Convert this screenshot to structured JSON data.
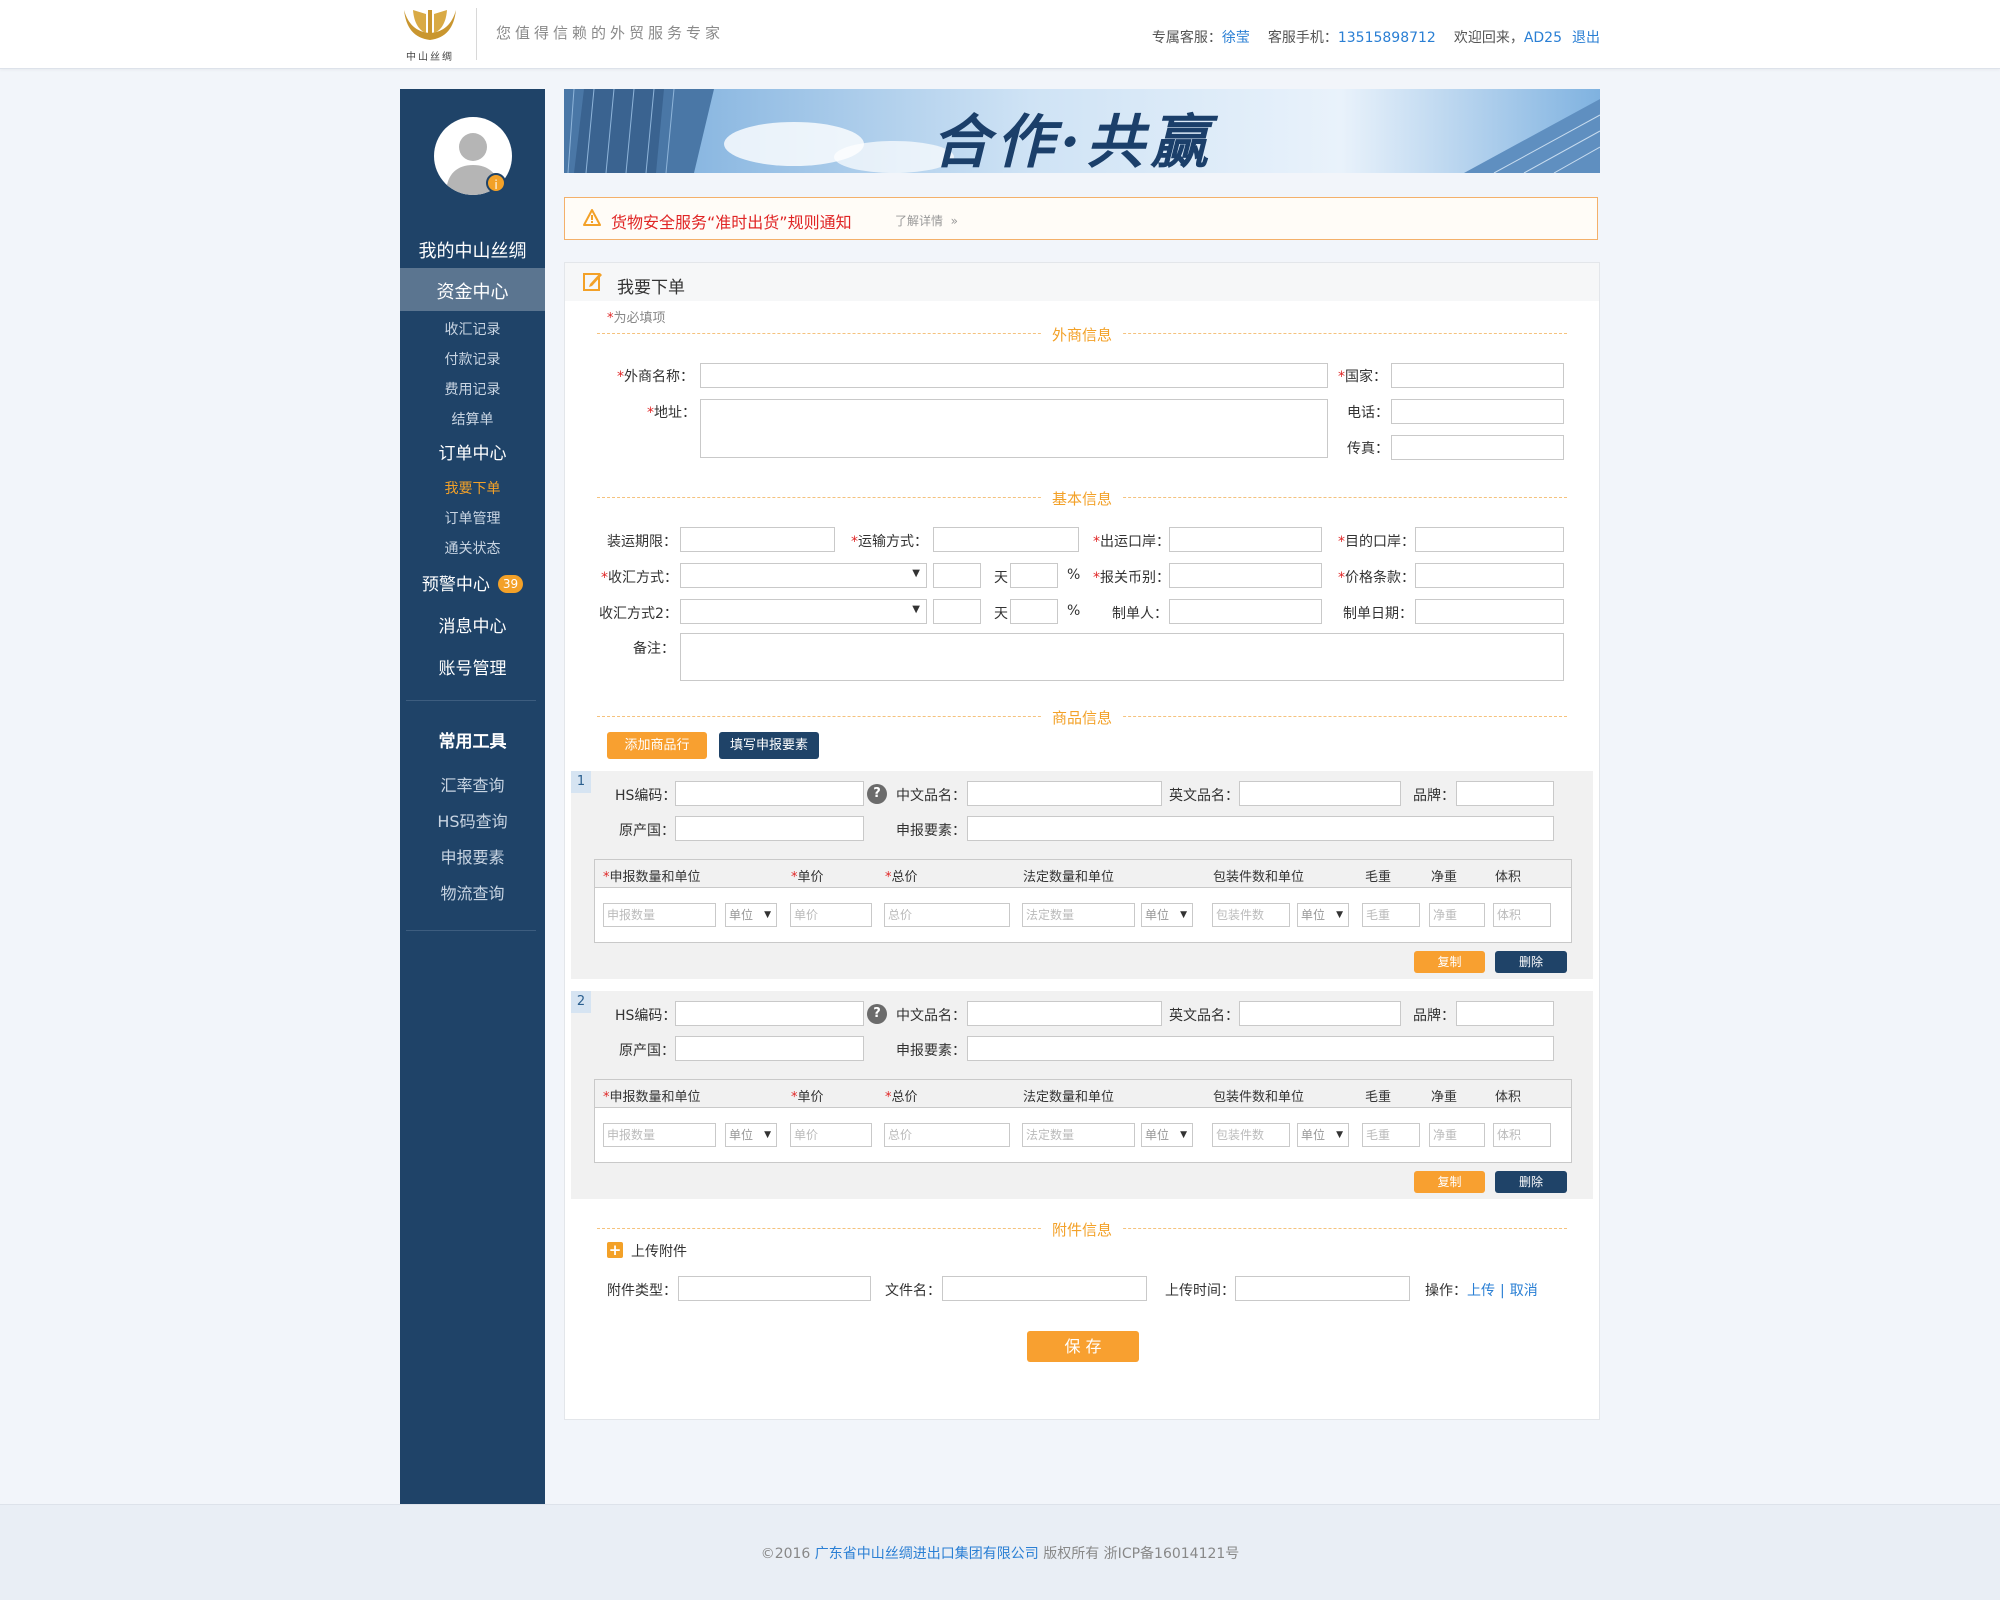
{
  "header": {
    "logo_text": "中山丝绸",
    "slogan": "您值得信赖的外贸服务专家",
    "service_label": "专属客服：",
    "service_name": "徐莹",
    "phone_label": "客服手机：",
    "phone": "13515898712",
    "welcome": "欢迎回来，",
    "user": "AD25",
    "logout": "退出"
  },
  "sidebar": {
    "my": "我的中山丝绸",
    "fund": "资金中心",
    "fund_items": [
      "收汇记录",
      "付款记录",
      "费用记录",
      "结算单"
    ],
    "order": "订单中心",
    "order_items": [
      "我要下单",
      "订单管理",
      "通关状态"
    ],
    "alert": "预警中心",
    "alert_count": "39",
    "message": "消息中心",
    "account": "账号管理",
    "tools": "常用工具",
    "tool_items": [
      "汇率查询",
      "HS码查询",
      "申报要素",
      "物流查询"
    ]
  },
  "banner": {
    "text": "合作·共赢"
  },
  "notice": {
    "text": "货物安全服务“准时出货”规则通知",
    "more": "了解详情",
    "more_arrow": "»"
  },
  "panel": {
    "title": "我要下单",
    "required_star": "*",
    "required_note": "为必填项"
  },
  "sections": {
    "foreign": "外商信息",
    "basic": "基本信息",
    "goods": "商品信息",
    "attach": "附件信息"
  },
  "foreign": {
    "name": "外商名称：",
    "country": "国家：",
    "address": "地址：",
    "phone": "电话：",
    "fax": "传真："
  },
  "basic": {
    "deadline": "装运期限：",
    "transport": "运输方式：",
    "port_out": "出运口岸：",
    "port_dest": "目的口岸：",
    "payment": "收汇方式：",
    "day": "天",
    "percent": "%",
    "currency": "报关币别：",
    "price_term": "价格条款：",
    "payment2": "收汇方式2：",
    "maker": "制单人：",
    "make_date": "制单日期：",
    "remark": "备注：",
    "select_arrow": "▼"
  },
  "goods": {
    "add_row": "添加商品行",
    "fill_elements": "填写申报要素",
    "hs": "HS编码：",
    "help": "?",
    "cn_name": "中文品名：",
    "en_name": "英文品名：",
    "brand": "品牌：",
    "origin": "原产国：",
    "elements": "申报要素：",
    "cols": {
      "qty_unit": "申报数量和单位",
      "unit_price": "单价",
      "total": "总价",
      "legal_qty": "法定数量和单位",
      "pkg": "包装件数和单位",
      "gross": "毛重",
      "net": "净重",
      "volume": "体积"
    },
    "placeholders": {
      "qty": "申报数量",
      "unit": "单位",
      "unit_price": "单价",
      "total": "总价",
      "legal_qty": "法定数量",
      "pkg": "包装件数",
      "gross": "毛重",
      "net": "净重",
      "volume": "体积"
    },
    "copy": "复制",
    "delete": "删除",
    "items": [
      {
        "num": "1"
      },
      {
        "num": "2"
      }
    ]
  },
  "attach": {
    "upload_title": "上传附件",
    "type": "附件类型：",
    "filename": "文件名：",
    "upload_time": "上传时间：",
    "op": "操作：",
    "upload": "上传",
    "sep": "|",
    "cancel": "取消"
  },
  "save": "保 存",
  "footer": {
    "copyright": "©2016",
    "company": "广东省中山丝绸进出口集团有限公司",
    "rights": "版权所有 浙ICP备16014121号"
  },
  "colors": {
    "sidebar": "#1f4368",
    "accent": "#f3a128",
    "link": "#2a7fd4",
    "alert_red": "#e02525"
  }
}
